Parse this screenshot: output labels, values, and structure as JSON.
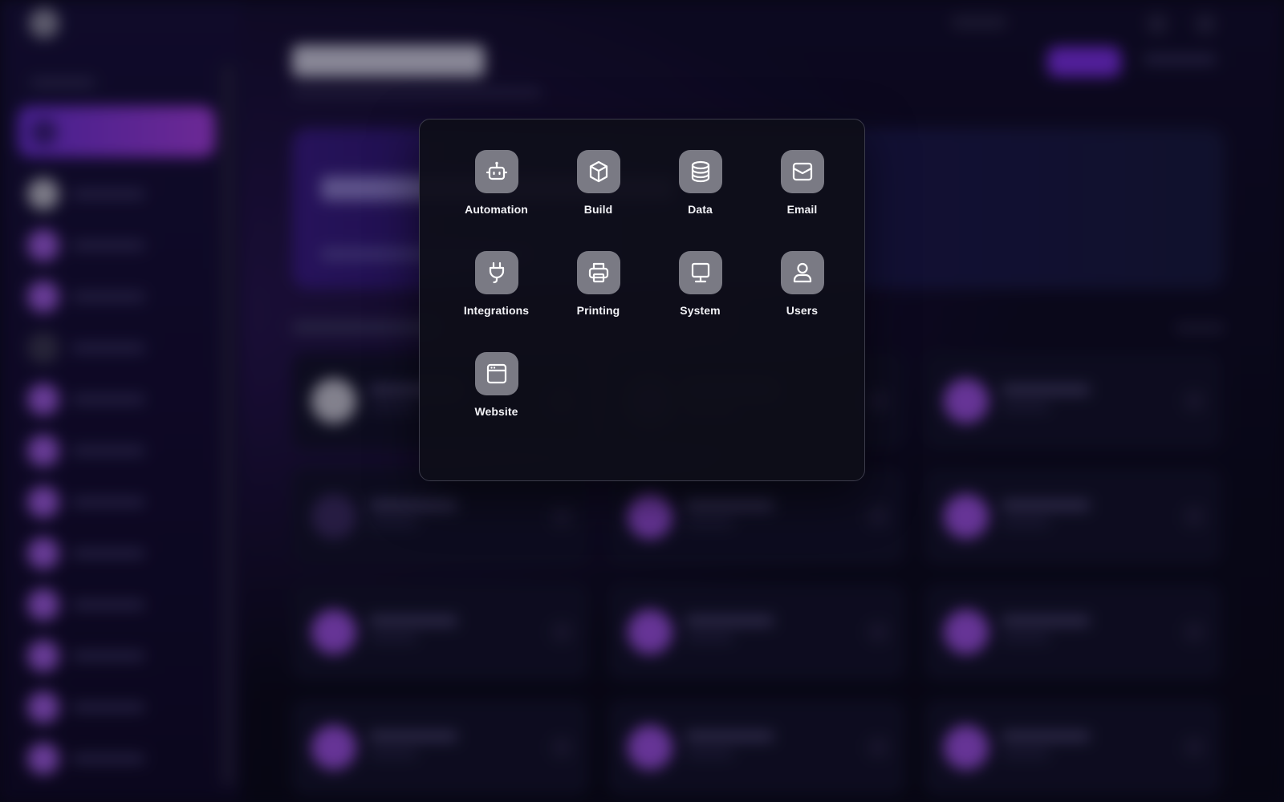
{
  "apps": [
    {
      "label": "Automation",
      "icon": "robot-icon"
    },
    {
      "label": "Build",
      "icon": "cube-icon"
    },
    {
      "label": "Data",
      "icon": "database-icon"
    },
    {
      "label": "Email",
      "icon": "envelope-icon"
    },
    {
      "label": "Integrations",
      "icon": "plug-icon"
    },
    {
      "label": "Printing",
      "icon": "printer-icon"
    },
    {
      "label": "System",
      "icon": "monitor-icon"
    },
    {
      "label": "Users",
      "icon": "user-icon"
    },
    {
      "label": "Website",
      "icon": "browser-window-icon"
    }
  ],
  "colors": {
    "panel_bg": "#0e0e18",
    "icon_tile_bg": "#7a7a84",
    "accent_purple": "#7c2ee6"
  }
}
